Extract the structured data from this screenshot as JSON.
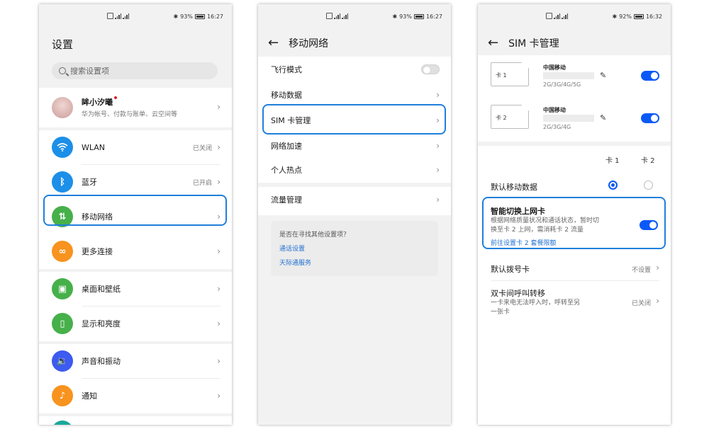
{
  "status_left": {
    "time": "16:27",
    "battery": "93%"
  },
  "status_right": {
    "time": "16:32",
    "battery": "92%"
  },
  "settings": {
    "title": "设置",
    "search_placeholder": "搜索设置项",
    "profile": {
      "name": "眸小汐曦",
      "subtitle": "华为帐号、付款与账单、云空间等"
    },
    "items": [
      {
        "label": "WLAN",
        "value": "已关闭"
      },
      {
        "label": "蓝牙",
        "value": "已开启"
      },
      {
        "label": "移动网络",
        "value": ""
      },
      {
        "label": "更多连接",
        "value": ""
      },
      {
        "label": "桌面和壁纸",
        "value": ""
      },
      {
        "label": "显示和亮度",
        "value": ""
      },
      {
        "label": "声音和振动",
        "value": ""
      },
      {
        "label": "通知",
        "value": ""
      }
    ]
  },
  "mobile_network": {
    "title": "移动网络",
    "items": [
      "飞行模式",
      "移动数据",
      "SIM 卡管理",
      "网络加速",
      "个人热点"
    ],
    "traffic": "流量管理",
    "suggest": {
      "title": "是否在寻找其他设置项？",
      "links": [
        "通话设置",
        "天际通服务"
      ]
    }
  },
  "sim_manage": {
    "title": "SIM 卡管理",
    "cards": [
      {
        "label": "卡 1",
        "carrier": "中国移动",
        "network": "2G/3G/4G/5G"
      },
      {
        "label": "卡 2",
        "carrier": "中国移动",
        "network": "2G/3G/4G"
      }
    ],
    "col1": "卡 1",
    "col2": "卡 2",
    "default_data": "默认移动数据",
    "smart_switch": {
      "title": "智能切换上网卡",
      "desc_line1": "根据网络质量状况和通话状态，暂时切",
      "desc_line2": "换至卡 2 上网，需消耗卡 2 流量",
      "link": "前往设置卡 2 套餐限额"
    },
    "default_dial": {
      "label": "默认拨号卡",
      "value": "不设置"
    },
    "call_forward": {
      "label": "双卡间呼叫转移",
      "desc_line1": "一卡来电无法呼入时，呼转至另",
      "desc_line2": "一张卡",
      "value": "已关闭"
    }
  },
  "colors": {
    "accent": "#0a59f7",
    "highlight": "#1f7fdc",
    "wlan": "#1c8fe8",
    "bluetooth": "#1c8fe8",
    "mobile": "#46b04a",
    "more": "#f7931e",
    "desktop": "#46b04a",
    "display": "#46b04a",
    "sound": "#3d5af1",
    "notify": "#f7931e"
  }
}
